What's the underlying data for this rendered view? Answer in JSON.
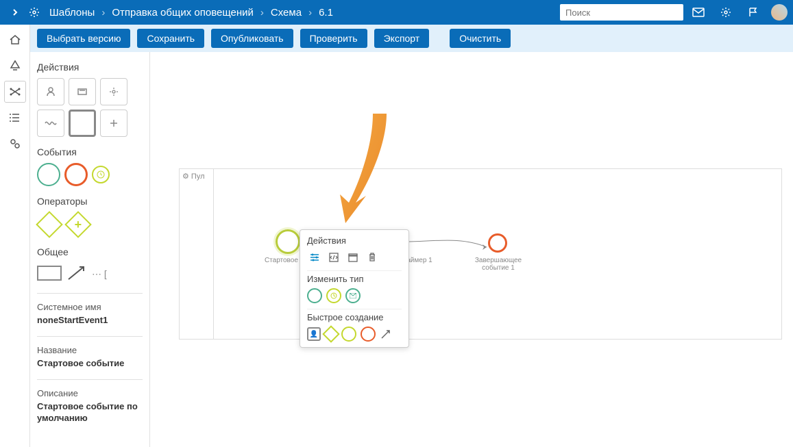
{
  "breadcrumbs": {
    "item1": "Шаблоны",
    "item2": "Отправка общих оповещений",
    "item3": "Схема",
    "item4": "6.1"
  },
  "search": {
    "placeholder": "Поиск"
  },
  "toolbar": {
    "select_version": "Выбрать версию",
    "save": "Сохранить",
    "publish": "Опубликовать",
    "check": "Проверить",
    "export": "Экспорт",
    "clear": "Очистить"
  },
  "sidebar": {
    "actions_title": "Действия",
    "events_title": "События",
    "operators_title": "Операторы",
    "general_title": "Общее",
    "sysname_label": "Системное имя",
    "sysname_value": "noneStartEvent1",
    "name_label": "Название",
    "name_value": "Стартовое событие",
    "desc_label": "Описание",
    "desc_value": "Стартовое событие по умолчанию"
  },
  "canvas": {
    "pool_label": "Пул",
    "start_label": "Стартовое соб",
    "timer_label": "аймер 1",
    "end_label": "Завершающее событие 1"
  },
  "context_menu": {
    "actions": "Действия",
    "change_type": "Изменить тип",
    "quick_create": "Быстрое создание"
  }
}
